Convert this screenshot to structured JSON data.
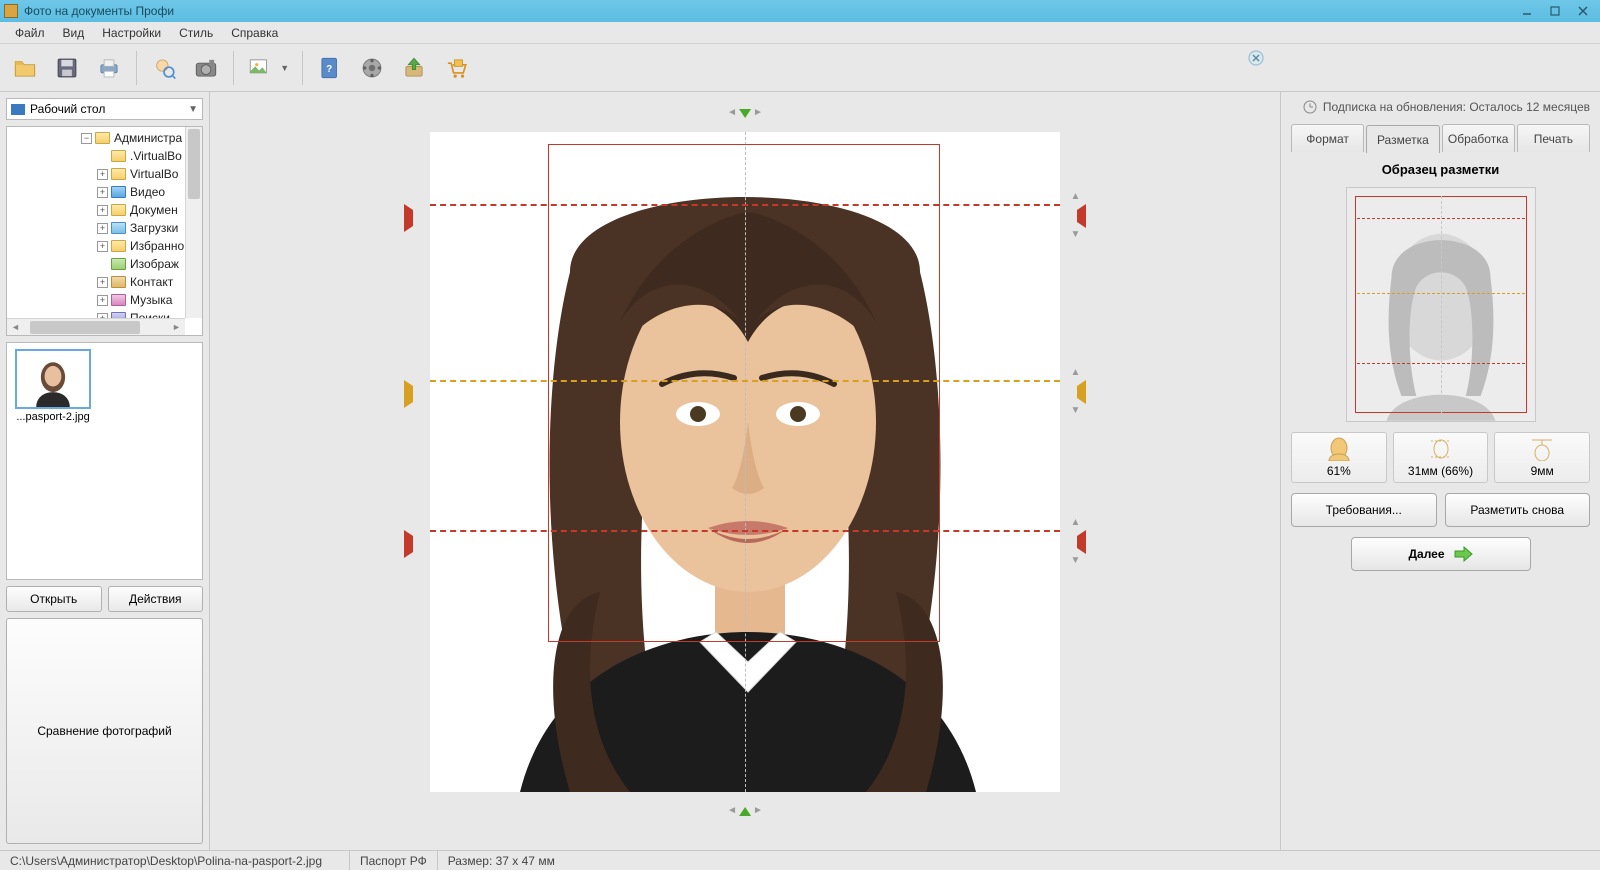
{
  "window": {
    "title": "Фото на документы Профи"
  },
  "menu": {
    "file": "Файл",
    "view": "Вид",
    "settings": "Настройки",
    "style": "Стиль",
    "help": "Справка"
  },
  "subscription": {
    "text": "Подписка на обновления: Осталось 12 месяцев"
  },
  "left": {
    "location": "Рабочий стол",
    "tree": {
      "root": "Администра",
      "items": [
        ".VirtualBo",
        "VirtualBo",
        "Видео",
        "Докумен",
        "Загрузки",
        "Избранно",
        "Изображ",
        "Контакт",
        "Музыка",
        "Поиски"
      ]
    },
    "thumb_label": "...pasport-2.jpg",
    "open": "Открыть",
    "actions": "Действия",
    "compare": "Сравнение фотографий"
  },
  "tabs": {
    "format": "Формат",
    "markup": "Разметка",
    "processing": "Обработка",
    "print": "Печать"
  },
  "right": {
    "sample_title": "Образец разметки",
    "metric1": "61%",
    "metric2": "31мм (66%)",
    "metric3": "9мм",
    "requirements": "Требования...",
    "remark": "Разметить снова",
    "next": "Далее"
  },
  "status": {
    "path": "C:\\Users\\Администратор\\Desktop\\Polina-na-pasport-2.jpg",
    "doc_type": "Паспорт РФ",
    "size": "Размер: 37 x 47 мм"
  }
}
